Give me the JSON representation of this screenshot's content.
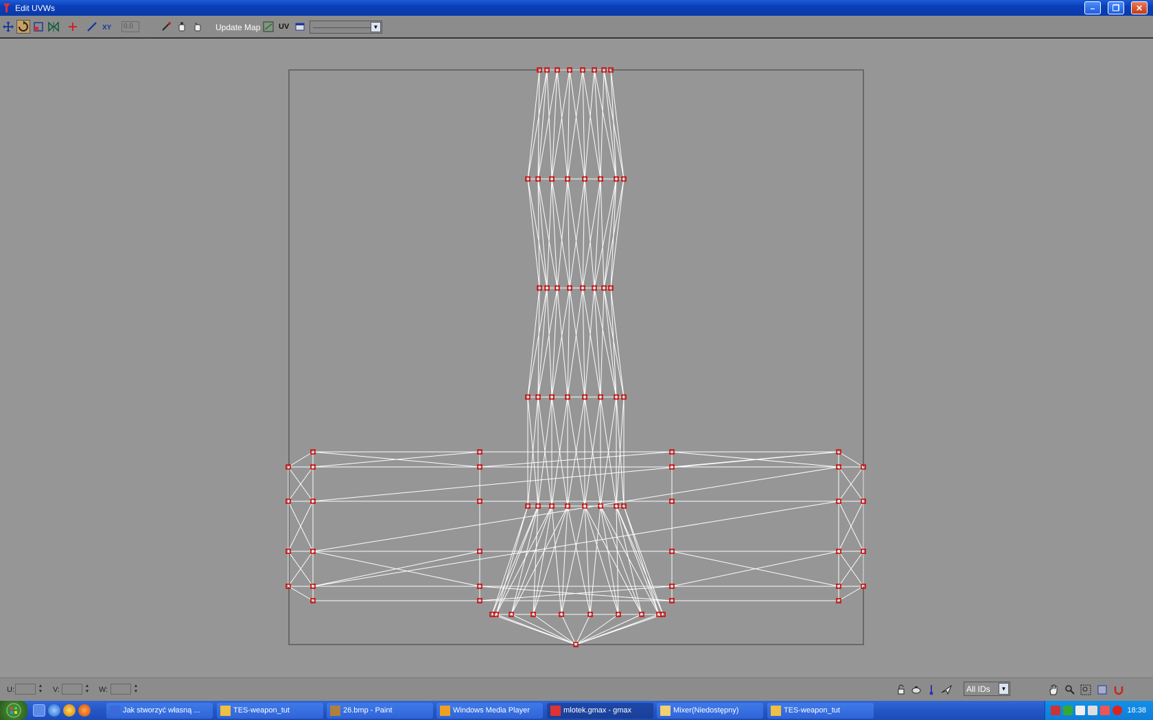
{
  "window": {
    "title": "Edit UVWs",
    "controls": {
      "minimize": "–",
      "restore": "❐",
      "close": "✕"
    }
  },
  "toolbar": {
    "spin_value": "0.0",
    "update_map_label": "Update Map",
    "uv_mode_label": "UV",
    "map_dropdown_value": ""
  },
  "statusbar": {
    "u_label": "U:",
    "v_label": "V:",
    "w_label": "W:",
    "u_value": "",
    "v_value": "",
    "w_value": "",
    "ids_select_value": "All IDs"
  },
  "taskbar": {
    "items": [
      {
        "label": "Jak stworzyć własną ...",
        "icon": "word-icon",
        "active": false
      },
      {
        "label": "TES-weapon_tut",
        "icon": "folder-icon",
        "active": false
      },
      {
        "label": "26.bmp - Paint",
        "icon": "paint-icon",
        "active": false
      },
      {
        "label": "Windows Media Player",
        "icon": "media-player-icon",
        "active": false
      },
      {
        "label": "mlotek.gmax - gmax",
        "icon": "gmax-icon",
        "active": true
      },
      {
        "label": "Mixer(Niedostępny)",
        "icon": "mail-icon",
        "active": false
      },
      {
        "label": "TES-weapon_tut",
        "icon": "folder-icon",
        "active": false
      }
    ],
    "clock": "18:38"
  },
  "colors": {
    "viewport_bg": "#969696",
    "wire": "#ffffff",
    "vertex": "#d40000",
    "uv_tile_border": "#5a5a5a"
  }
}
